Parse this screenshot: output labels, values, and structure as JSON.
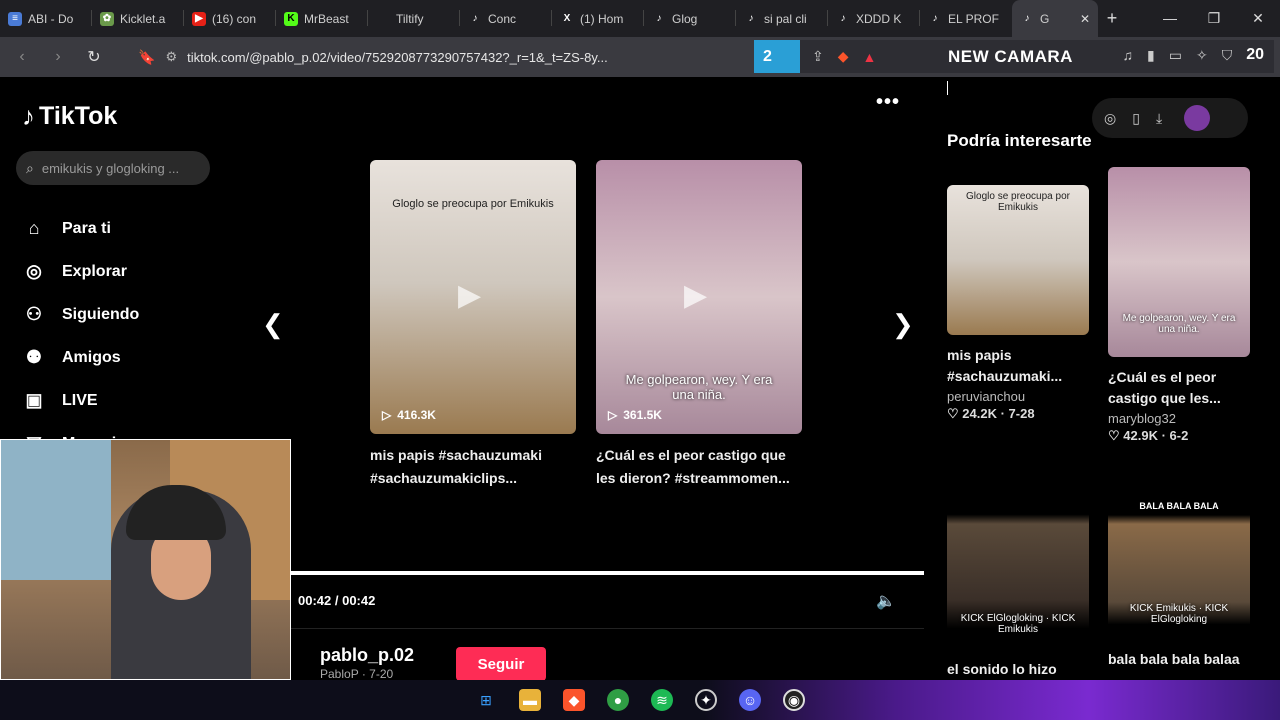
{
  "tabs": [
    {
      "label": "ABI - Do",
      "icon": "docs-icon",
      "color": "#4a7bd6"
    },
    {
      "label": "Kicklet.a",
      "icon": "kicklet-icon",
      "color": "#6a9a4a"
    },
    {
      "label": "(16) con",
      "icon": "youtube-icon",
      "color": "#e62117"
    },
    {
      "label": "MrBeast",
      "icon": "kick-icon",
      "color": "#53fc18"
    },
    {
      "label": "Tiltify",
      "icon": "tiltify-icon",
      "color": "#1f1f23"
    },
    {
      "label": "Conc",
      "icon": "tiktok-icon",
      "color": "#1f1f23"
    },
    {
      "label": "(1) Hom",
      "icon": "x-icon",
      "color": "#1f1f23"
    },
    {
      "label": "Glog",
      "icon": "tiktok-icon",
      "color": "#1f1f23"
    },
    {
      "label": "si pal cli",
      "icon": "tiktok-icon",
      "color": "#1f1f23"
    },
    {
      "label": "XDDD K",
      "icon": "tiktok-icon",
      "color": "#1f1f23"
    },
    {
      "label": "EL PROF",
      "icon": "tiktok-icon",
      "color": "#1f1f23"
    }
  ],
  "active_tab": {
    "label": "G",
    "icon": "tiktok-icon"
  },
  "address": {
    "url": "tiktok.com/@pablo_p.02/video/7529208773290757432?_r=1&_t=ZS-8y..."
  },
  "extension_bar": {
    "badge": "2",
    "title": "NEW CAMARA",
    "counter": "20"
  },
  "sidebar": {
    "brand": "TikTok",
    "search_placeholder": "emikukis y glogloking ...",
    "items": [
      {
        "label": "Para ti",
        "icon": "home-icon"
      },
      {
        "label": "Explorar",
        "icon": "compass-icon"
      },
      {
        "label": "Siguiendo",
        "icon": "following-icon"
      },
      {
        "label": "Amigos",
        "icon": "friends-icon"
      },
      {
        "label": "LIVE",
        "icon": "live-icon"
      },
      {
        "label": "Mensajes",
        "icon": "messages-icon"
      }
    ]
  },
  "carousel": {
    "cards": [
      {
        "thumb_caption": "Gloglo se preocupa por Emikukis",
        "views": "416.3K",
        "desc_line1": "mis papis #sachauzumaki",
        "desc_line2": "#sachauzumakiclips..."
      },
      {
        "thumb_caption": "Me golpearon, wey. Y era una niña.",
        "views": "361.5K",
        "desc_line1": "¿Cuál es el peor castigo que",
        "desc_line2": "les dieron? #streammomen..."
      }
    ]
  },
  "player": {
    "time": "00:42 / 00:42",
    "progress": 1.0
  },
  "author": {
    "name": "pablo_p.02",
    "sub": "PabloP · 7-20",
    "follow_label": "Seguir"
  },
  "suggested": {
    "title": "Podría interesarte",
    "videos": [
      {
        "thumb_text": "Gloglo se preocupa por Emikukis",
        "title_line1": "mis papis",
        "title_line2": "#sachauzumaki...",
        "user": "peruvianchou",
        "stats": "24.2K · 7-28"
      },
      {
        "thumb_text": "Me golpearon, wey. Y era una niña.",
        "title_line1": "¿Cuál es el peor",
        "title_line2": "castigo que les...",
        "user": "maryblog32",
        "stats": "42.9K · 6-2"
      },
      {
        "thumb_text": "KICK ElGlogloking · KICK Emikukis",
        "title_line1": "el sonido lo hizo"
      },
      {
        "top_label": "BALA BALA BALA",
        "thumb_text": "KICK Emikukis · KICK ElGlogloking",
        "title_line1": "bala bala bala balaa"
      }
    ]
  },
  "taskbar": {
    "icons": [
      "windows-icon",
      "folder-icon",
      "brave-icon",
      "chrome-icon",
      "spotify-icon",
      "app-icon",
      "discord-icon",
      "obs-icon"
    ]
  },
  "colors": {
    "follow": "#fe2c55",
    "extension_badge": "#2a9fd6",
    "accent_taskbar": "#7a2ad0"
  }
}
